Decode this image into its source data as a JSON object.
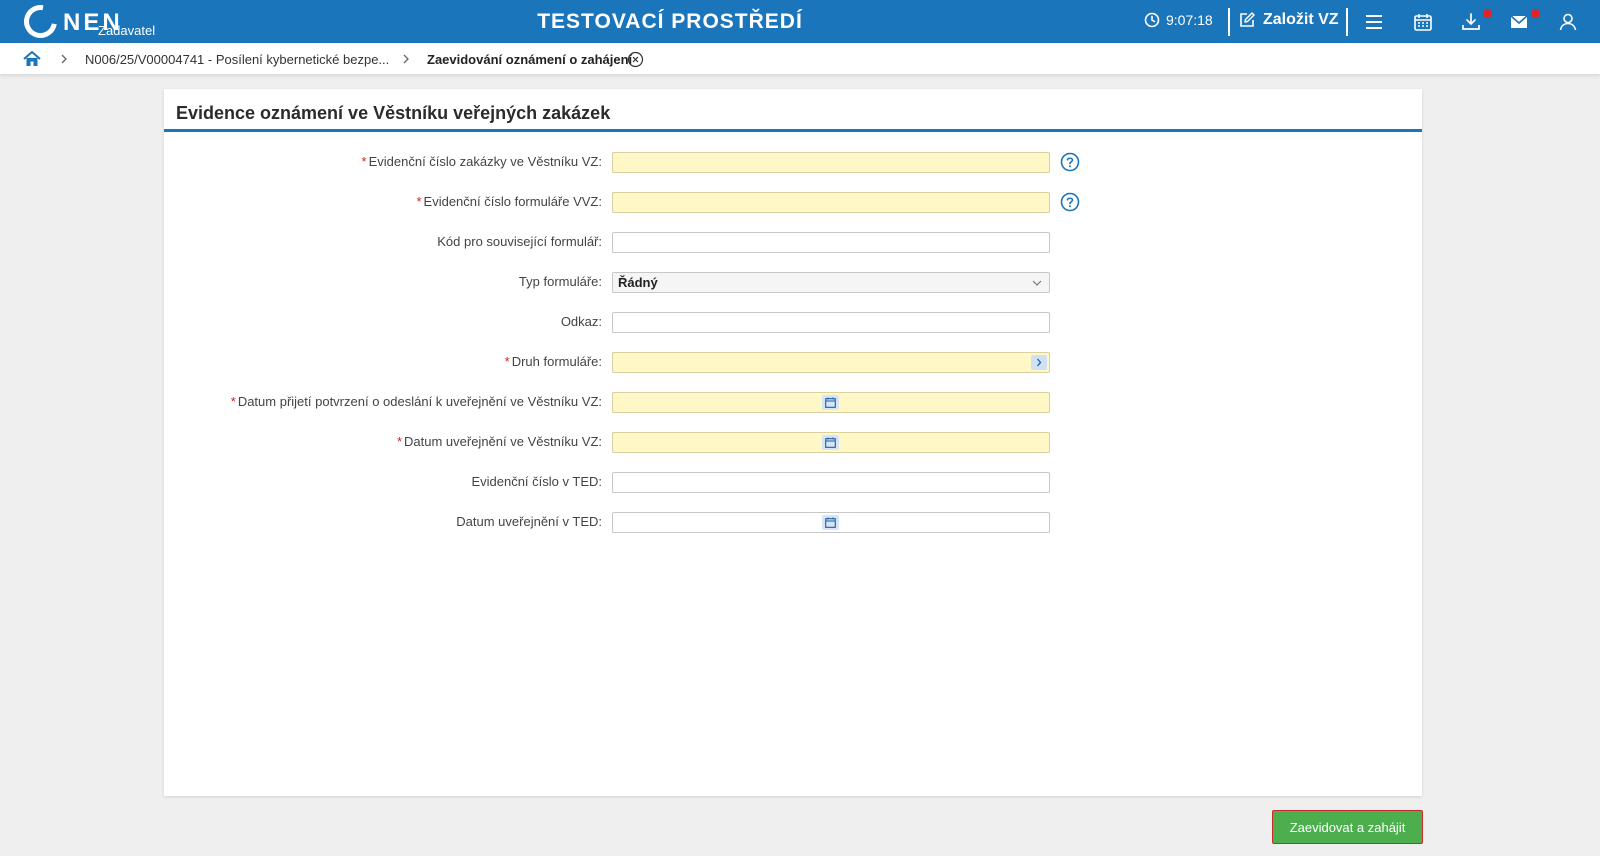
{
  "header": {
    "logo_text": "NEN",
    "logo_sub": "Zadavatel",
    "env_title": "TESTOVACÍ PROSTŘEDÍ",
    "clock": "9:07:18",
    "create_label": "Založit VZ",
    "icons": [
      "clock-icon",
      "edit-icon",
      "menu-icon",
      "calendar-icon",
      "download-icon",
      "mail-icon",
      "user-icon"
    ],
    "accent": "#1b75bb",
    "badge_color": "#e02424"
  },
  "breadcrumb": {
    "items": [
      "N006/25/V00004741 - Posílení kybernetické bezpe...",
      "Zaevidování oznámení o zahájení"
    ]
  },
  "form": {
    "title": "Evidence oznámení ve Věstníku veřejných zakázek",
    "fields": [
      {
        "label": "Evidenční číslo zakázky ve Věstníku VZ:",
        "required": true,
        "value": "",
        "help": true
      },
      {
        "label": "Evidenční číslo formuláře VVZ:",
        "required": true,
        "value": "",
        "help": true
      },
      {
        "label": "Kód pro související formulář:",
        "required": false,
        "value": ""
      },
      {
        "label": "Typ formuláře:",
        "required": false,
        "value": "Řádný",
        "type": "select"
      },
      {
        "label": "Odkaz:",
        "required": false,
        "value": ""
      },
      {
        "label": "Druh formuláře:",
        "required": true,
        "value": "",
        "type": "picker"
      },
      {
        "label": "Datum přijetí potvrzení o odeslání k uveřejnění ve Věstníku VZ:",
        "required": true,
        "value": "",
        "type": "date"
      },
      {
        "label": "Datum uveřejnění ve Věstníku VZ:",
        "required": true,
        "value": "",
        "type": "date"
      },
      {
        "label": "Evidenční číslo v TED:",
        "required": false,
        "value": ""
      },
      {
        "label": "Datum uveřejnění v TED:",
        "required": false,
        "value": "",
        "type": "date"
      }
    ],
    "required_mark": "*",
    "required_bg": "#fff8c6"
  },
  "actions": {
    "submit_label": "Zaevidovat a zahájit",
    "submit_color": "#4cae4c"
  }
}
